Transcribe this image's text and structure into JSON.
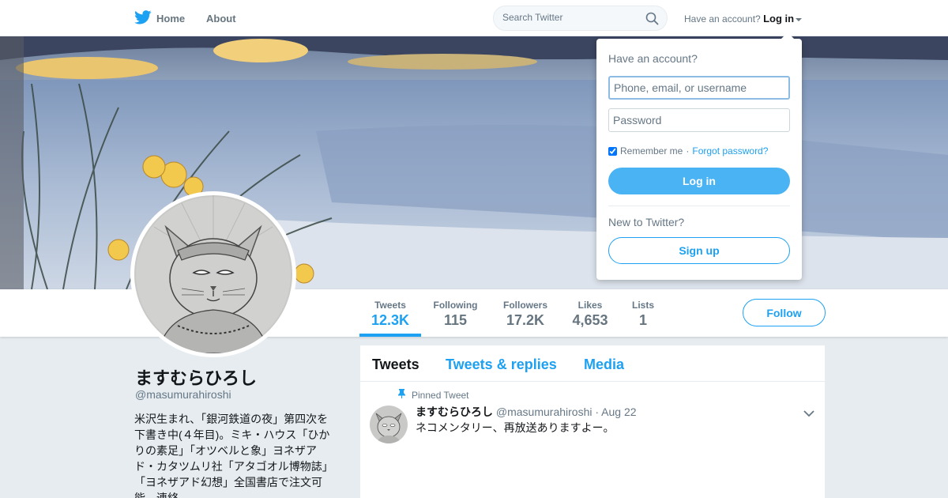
{
  "nav": {
    "home_label": "Home",
    "about_label": "About",
    "search_placeholder": "Search Twitter",
    "account_prompt": "Have an account?",
    "login_label": "Log in"
  },
  "colors": {
    "accent": "#1da1f2",
    "button_fill": "#4ab3f4",
    "page_bg": "#e6ecf0"
  },
  "profile": {
    "name": "ますむらひろし",
    "handle": "@masumurahiroshi",
    "bio_lines": [
      "米沢生まれ、「銀河鉄道の夜」第四次を",
      "下書き中(４年目)。ミキ・ハウス「ひか",
      "りの素足」「オツベルと象」ヨネザア",
      "ド・カタツムリ社「アタゴオル博物誌」",
      "「ヨネザアド幻想」全国書店で注文可",
      "能。連絡"
    ]
  },
  "stats": [
    {
      "label": "Tweets",
      "value": "12.3K"
    },
    {
      "label": "Following",
      "value": "115"
    },
    {
      "label": "Followers",
      "value": "17.2K"
    },
    {
      "label": "Likes",
      "value": "4,653"
    },
    {
      "label": "Lists",
      "value": "1"
    }
  ],
  "follow_label": "Follow",
  "timeline": {
    "tabs": [
      "Tweets",
      "Tweets & replies",
      "Media"
    ],
    "pinned_label": "Pinned Tweet",
    "tweet": {
      "name": "ますむらひろし",
      "handle": "@masumurahiroshi",
      "separator": "·",
      "date": "Aug 22",
      "text": "ネコメンタリー、再放送ありますよー。"
    }
  },
  "login_dropdown": {
    "title": "Have an account?",
    "username_placeholder": "Phone, email, or username",
    "password_placeholder": "Password",
    "remember_label": "Remember me",
    "separator": "·",
    "forgot_label": "Forgot password?",
    "login_button": "Log in",
    "new_prompt": "New to Twitter?",
    "signup_button": "Sign up"
  }
}
